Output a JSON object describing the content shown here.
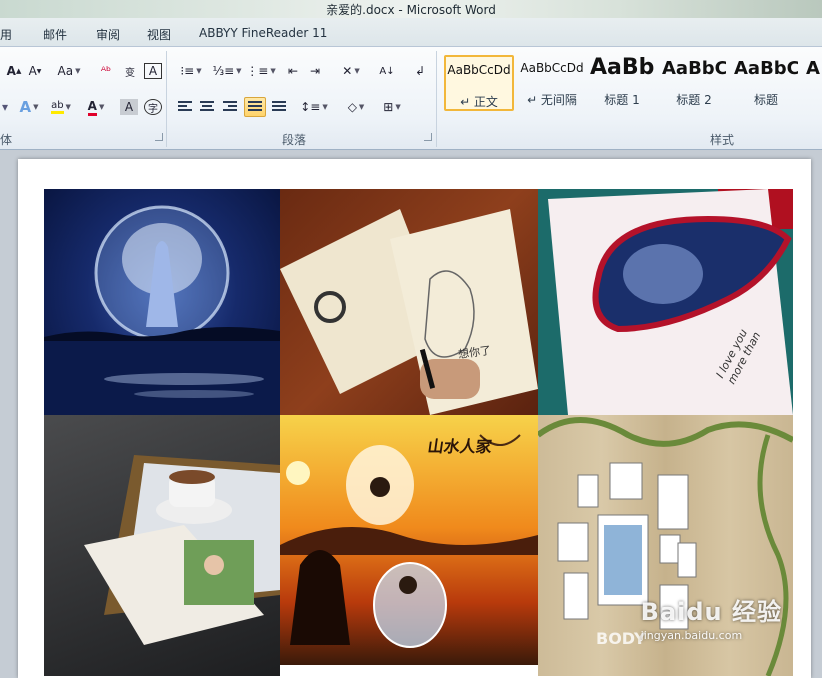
{
  "window": {
    "title": "亲爱的.docx - Microsoft Word"
  },
  "tabs": [
    "用",
    "邮件",
    "审阅",
    "视图",
    "ABBYY FineReader 11"
  ],
  "ribbon": {
    "groups": {
      "font": "体",
      "paragraph": "段落",
      "styles": "样式"
    },
    "styles": [
      {
        "sample": "AaBbCcDd",
        "name": "↵ 正文"
      },
      {
        "sample": "AaBbCcDd",
        "name": "↵ 无间隔"
      },
      {
        "sample": "AaBb",
        "name": "标题 1"
      },
      {
        "sample": "AaBbC",
        "name": "标题 2"
      },
      {
        "sample": "AaBbC",
        "name": "标题"
      },
      {
        "sample": "A",
        "name": ""
      }
    ]
  },
  "photos": {
    "card_text": "I love you more than",
    "sketch_caption": "想你了",
    "poster_title": "山水人家",
    "body_label": "BODY"
  },
  "watermark": {
    "brand": "Baidu 经验",
    "url": "jingyan.baidu.com"
  },
  "colors": {
    "accent": "#f2b73a",
    "ribbon": "#eef3f8",
    "page": "#ffffff"
  }
}
